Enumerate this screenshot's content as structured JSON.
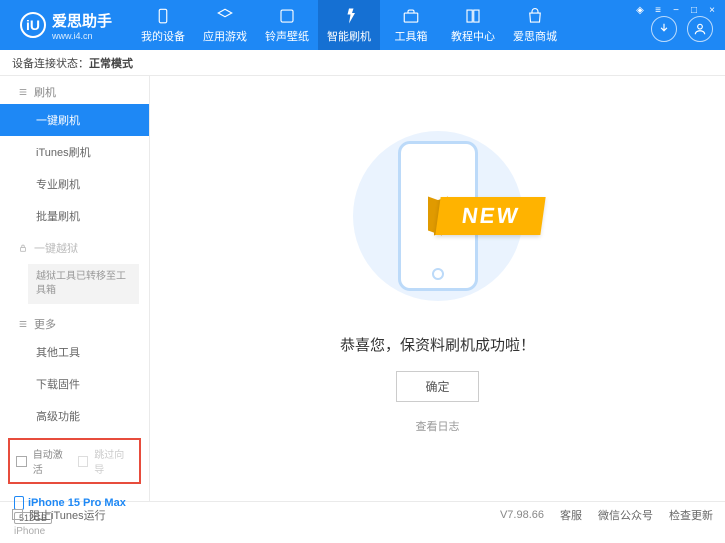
{
  "brand": {
    "name": "爱思助手",
    "url": "www.i4.cn",
    "logoLetter": "iU"
  },
  "nav": {
    "tabs": [
      {
        "label": "我的设备"
      },
      {
        "label": "应用游戏"
      },
      {
        "label": "铃声壁纸"
      },
      {
        "label": "智能刷机"
      },
      {
        "label": "工具箱"
      },
      {
        "label": "教程中心"
      },
      {
        "label": "爱思商城"
      }
    ]
  },
  "status": {
    "label": "设备连接状态：",
    "value": "正常模式"
  },
  "sidebar": {
    "sectionFlash": "刷机",
    "items": [
      {
        "label": "一键刷机"
      },
      {
        "label": "iTunes刷机"
      },
      {
        "label": "专业刷机"
      },
      {
        "label": "批量刷机"
      }
    ],
    "sectionJailbreak": "一键越狱",
    "jailbreakNote": "越狱工具已转移至工具箱",
    "sectionMore": "更多",
    "moreItems": [
      {
        "label": "其他工具"
      },
      {
        "label": "下载固件"
      },
      {
        "label": "高级功能"
      }
    ],
    "checkboxes": {
      "autoActivate": "自动激活",
      "skipGuide": "跳过向导"
    },
    "device": {
      "name": "iPhone 15 Pro Max",
      "storage": "512GB",
      "model": "iPhone"
    }
  },
  "content": {
    "ribbon": "NEW",
    "successMsg": "恭喜您，保资料刷机成功啦！",
    "okButton": "确定",
    "viewLog": "查看日志"
  },
  "footer": {
    "blockItunes": "阻止iTunes运行",
    "version": "V7.98.66",
    "links": [
      "客服",
      "微信公众号",
      "检查更新"
    ]
  }
}
